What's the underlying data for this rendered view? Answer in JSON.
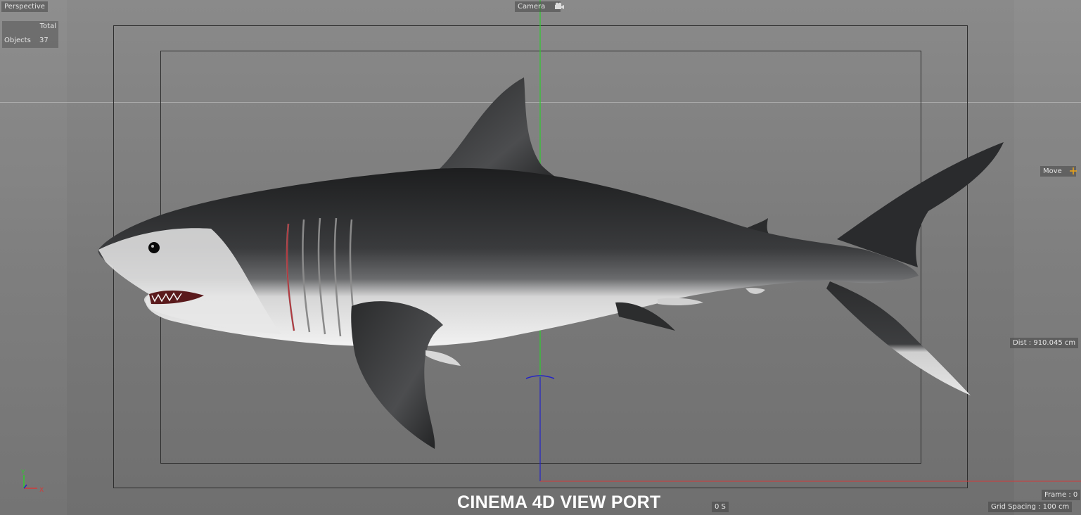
{
  "viewport": {
    "view_name": "Perspective",
    "camera_label": "Camera",
    "stats": {
      "total_label": "Total",
      "objects_label": "Objects",
      "objects_count": "37"
    },
    "tool_label": "Move",
    "distance": "Dist : 910.045 cm",
    "frame": "Frame : 0",
    "grid_spacing": "Grid Spacing : 100 cm",
    "time": "0 S",
    "axis_labels": {
      "y": "Y",
      "x": "X"
    },
    "caption": "CINEMA 4D VIEW PORT"
  },
  "colors": {
    "y_axis": "#2ecc2e",
    "z_axis": "#2323c8",
    "x_axis": "#d23a3a",
    "move_icon": "#e8a21a"
  },
  "icons": {
    "camera": "camera-icon",
    "move": "move-icon",
    "axis_gizmo": "axis-gizmo-icon"
  }
}
